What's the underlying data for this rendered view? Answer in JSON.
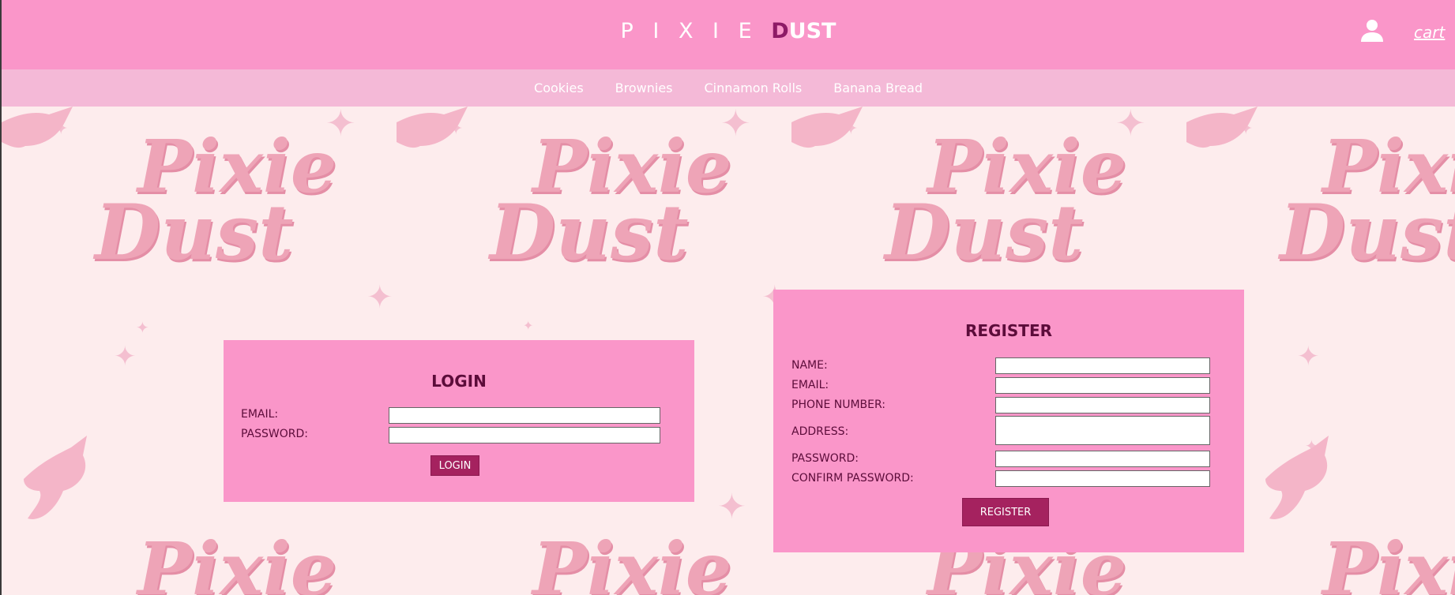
{
  "header": {
    "brand_light": "P I X I E ",
    "brand_accent": "D",
    "brand_rest": "UST",
    "user_icon": "user-icon",
    "cart_label": "cart"
  },
  "nav": {
    "items": [
      "Cookies",
      "Brownies",
      "Cinnamon Rolls",
      "Banana Bread"
    ]
  },
  "background": {
    "watermark_line1": "Pixie",
    "watermark_line2": "Dust"
  },
  "login": {
    "title": "LOGIN",
    "email_label": "EMAIL:",
    "email_value": "",
    "password_label": "PASSWORD:",
    "password_value": "",
    "button_label": "LOGIN"
  },
  "register": {
    "title": "REGISTER",
    "name_label": "NAME:",
    "email_label": "EMAIL:",
    "phone_label": "PHONE NUMBER:",
    "address_label": "ADDRESS:",
    "password_label": "PASSWORD:",
    "confirm_label": "CONFIRM PASSWORD:",
    "button_label": "REGISTER"
  },
  "colors": {
    "header_bg": "#fa96c9",
    "nav_bg": "#f4b9d7",
    "panel_bg": "#fa96c9",
    "button_bg": "#a5225f",
    "title_text": "#5c0c3a",
    "accent": "#8e1a66",
    "page_bg": "#fdeced"
  }
}
